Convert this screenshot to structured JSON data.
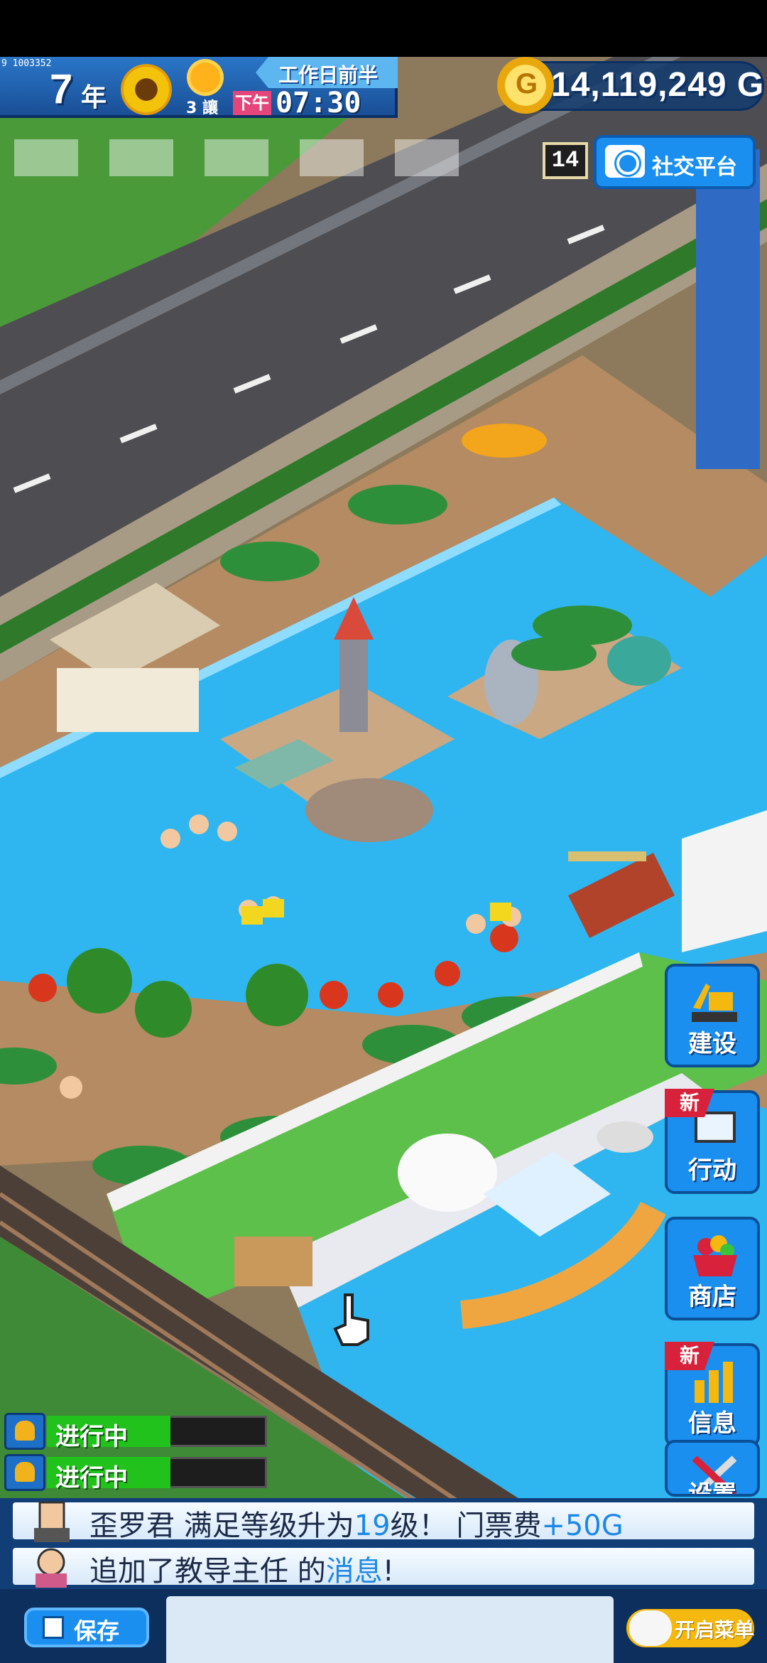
{
  "hud": {
    "id_text": "9 1003352",
    "year_number": "7",
    "year_label": "年",
    "week": "3 讓",
    "phase": "工作日前半",
    "ampm": "下午",
    "time": "07:30"
  },
  "gold": {
    "symbol": "G",
    "value": "14,119,249 G"
  },
  "social": {
    "level": "14",
    "label": "社交平台"
  },
  "side_menu": [
    {
      "label": "建设",
      "new": false
    },
    {
      "label": "行动",
      "new": true
    },
    {
      "label": "商店",
      "new": false
    },
    {
      "label": "信息",
      "new": true
    },
    {
      "label": "设置",
      "new": false
    }
  ],
  "badge_new": "新",
  "progress": [
    {
      "label": "进行中",
      "fill": 0.56
    },
    {
      "label": "进行中",
      "fill": 0.56
    }
  ],
  "news": [
    {
      "prefix": "歪罗君 满足等级升为",
      "level": "19",
      "mid": "级！ 门票费",
      "bonus": "+50G"
    },
    {
      "prefix": "追加了教导主任 的",
      "highlight": "消息",
      "suffix": "!"
    }
  ],
  "bottom": {
    "save_label": "保存",
    "menu_label": "开启菜单"
  },
  "colors": {
    "hud_blue": "#1a8ff0",
    "water": "#2fb6f0",
    "grass": "#4fb33a",
    "gold": "#f4b80f"
  }
}
